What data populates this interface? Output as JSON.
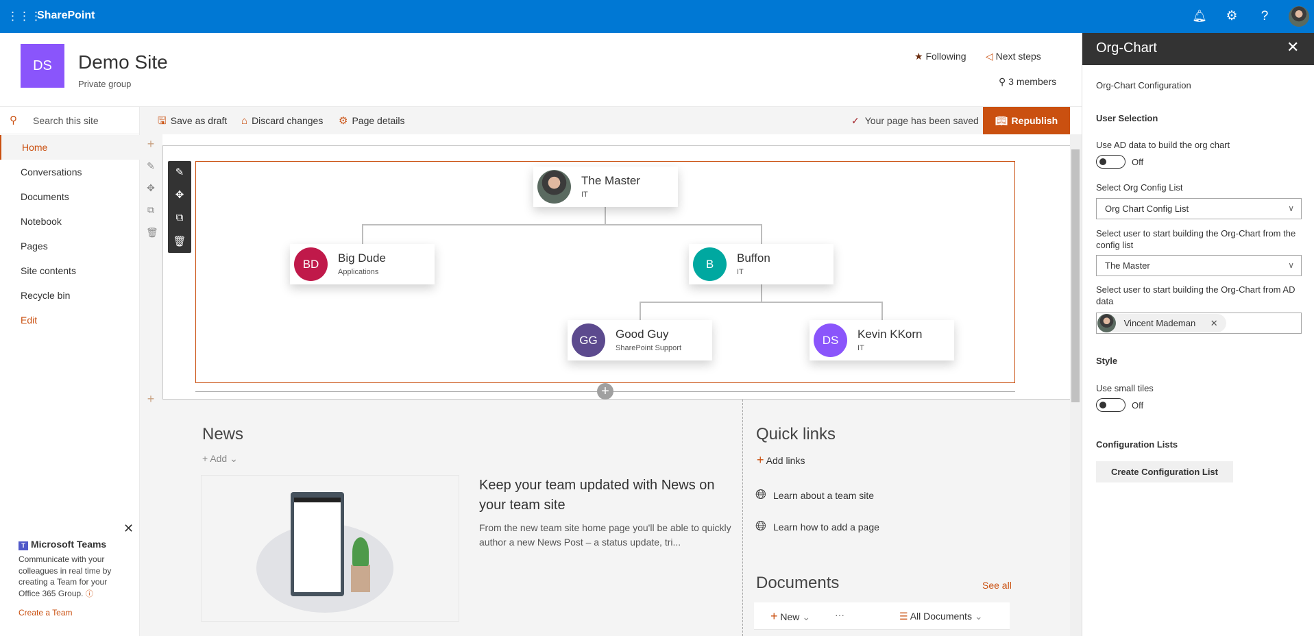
{
  "topbar": {
    "app": "SharePoint",
    "icons": [
      "waffle-icon",
      "bell-icon",
      "gear-icon",
      "help-icon",
      "avatar"
    ]
  },
  "header": {
    "logo_initials": "DS",
    "logo_color": "#8a55fb",
    "title": "Demo Site",
    "subtitle": "Private group",
    "following": "Following",
    "next_steps": "Next steps",
    "members": "3 members"
  },
  "nav": {
    "search_placeholder": "Search this site",
    "items": [
      {
        "label": "Home"
      },
      {
        "label": "Conversations"
      },
      {
        "label": "Documents"
      },
      {
        "label": "Notebook"
      },
      {
        "label": "Pages"
      },
      {
        "label": "Site contents"
      },
      {
        "label": "Recycle bin"
      },
      {
        "label": "Edit"
      }
    ],
    "teams": {
      "title": "Microsoft Teams",
      "lines": [
        "Communicate with your",
        "colleagues in real time by",
        "creating a Team for your",
        "Office 365 Group."
      ],
      "link": "Create a Team"
    }
  },
  "cmdbar": {
    "save_draft": "Save as draft",
    "discard": "Discard changes",
    "page_details": "Page details",
    "status": "Your page has been saved",
    "republish": "Republish"
  },
  "orgchart": {
    "nodes": [
      {
        "name": "The Master",
        "dept": "IT",
        "initials": "",
        "color": ""
      },
      {
        "name": "Big Dude",
        "dept": "Applications",
        "initials": "BD",
        "color": "#c0194a"
      },
      {
        "name": "Buffon",
        "dept": "IT",
        "initials": "B",
        "color": "#00a8a0"
      },
      {
        "name": "Good Guy",
        "dept": "SharePoint Support",
        "initials": "GG",
        "color": "#5c4a8e"
      },
      {
        "name": "Kevin KKorn",
        "dept": "IT",
        "initials": "DS",
        "color": "#8a55fb"
      }
    ]
  },
  "news": {
    "title": "News",
    "add": "Add",
    "headline": "Keep your team updated with News on your team site",
    "body": "From the new team site home page you'll be able to quickly author a new News Post – a status update, tri..."
  },
  "quicklinks": {
    "title": "Quick links",
    "add": "Add links",
    "links": [
      "Learn about a team site",
      "Learn how to add a page"
    ]
  },
  "documents": {
    "title": "Documents",
    "see_all": "See all",
    "new": "New",
    "view": "All Documents"
  },
  "panel": {
    "title": "Org-Chart",
    "subtitle": "Org-Chart Configuration",
    "user_selection": "User Selection",
    "use_ad_label": "Use AD data to build the org chart",
    "use_ad_state": "Off",
    "config_list_label": "Select Org Config List",
    "config_list_value": "Org Chart Config List",
    "start_user_label": "Select user to start building the Org-Chart from the config list",
    "start_user_value": "The Master",
    "ad_user_label": "Select user to start building the Org-Chart from AD data",
    "ad_user_value": "Vincent Mademan",
    "style": "Style",
    "small_tiles_label": "Use small tiles",
    "small_tiles_state": "Off",
    "config_lists": "Configuration Lists",
    "create_button": "Create Configuration List"
  },
  "colors": {
    "brand": "#0078d4",
    "accent": "#ca5010",
    "panel_header": "#333333"
  }
}
